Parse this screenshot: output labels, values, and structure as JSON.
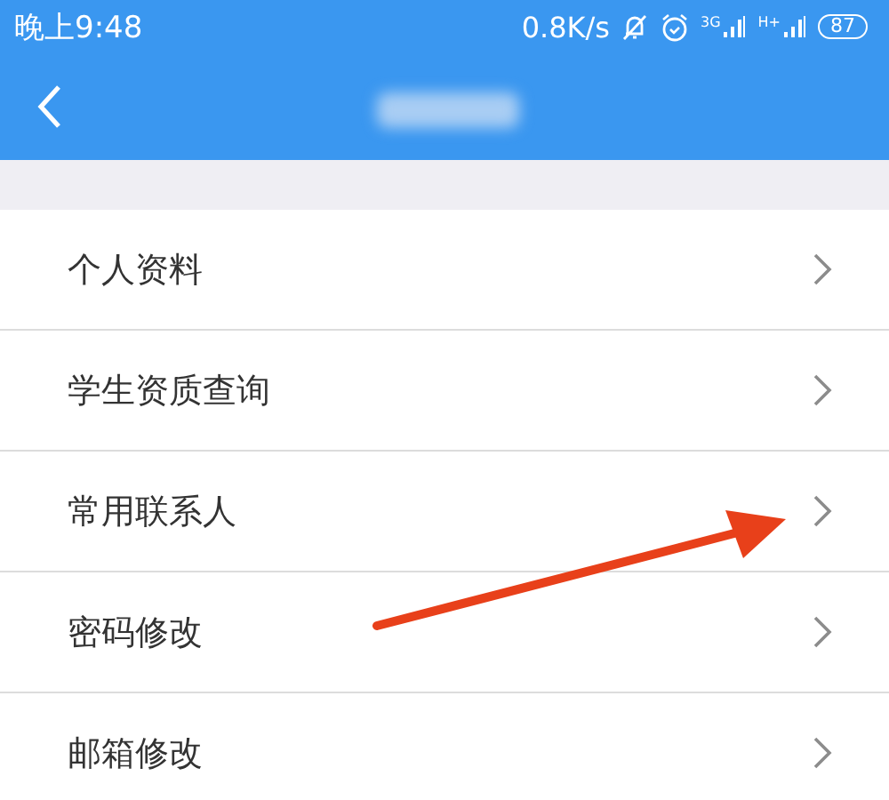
{
  "status_bar": {
    "time": "晚上9:48",
    "speed": "0.8K/s",
    "net_3g": "3G",
    "net_h": "H+",
    "battery": "87"
  },
  "menu": [
    {
      "label": "个人资料"
    },
    {
      "label": "学生资质查询"
    },
    {
      "label": "常用联系人"
    },
    {
      "label": "密码修改"
    },
    {
      "label": "邮箱修改"
    }
  ]
}
